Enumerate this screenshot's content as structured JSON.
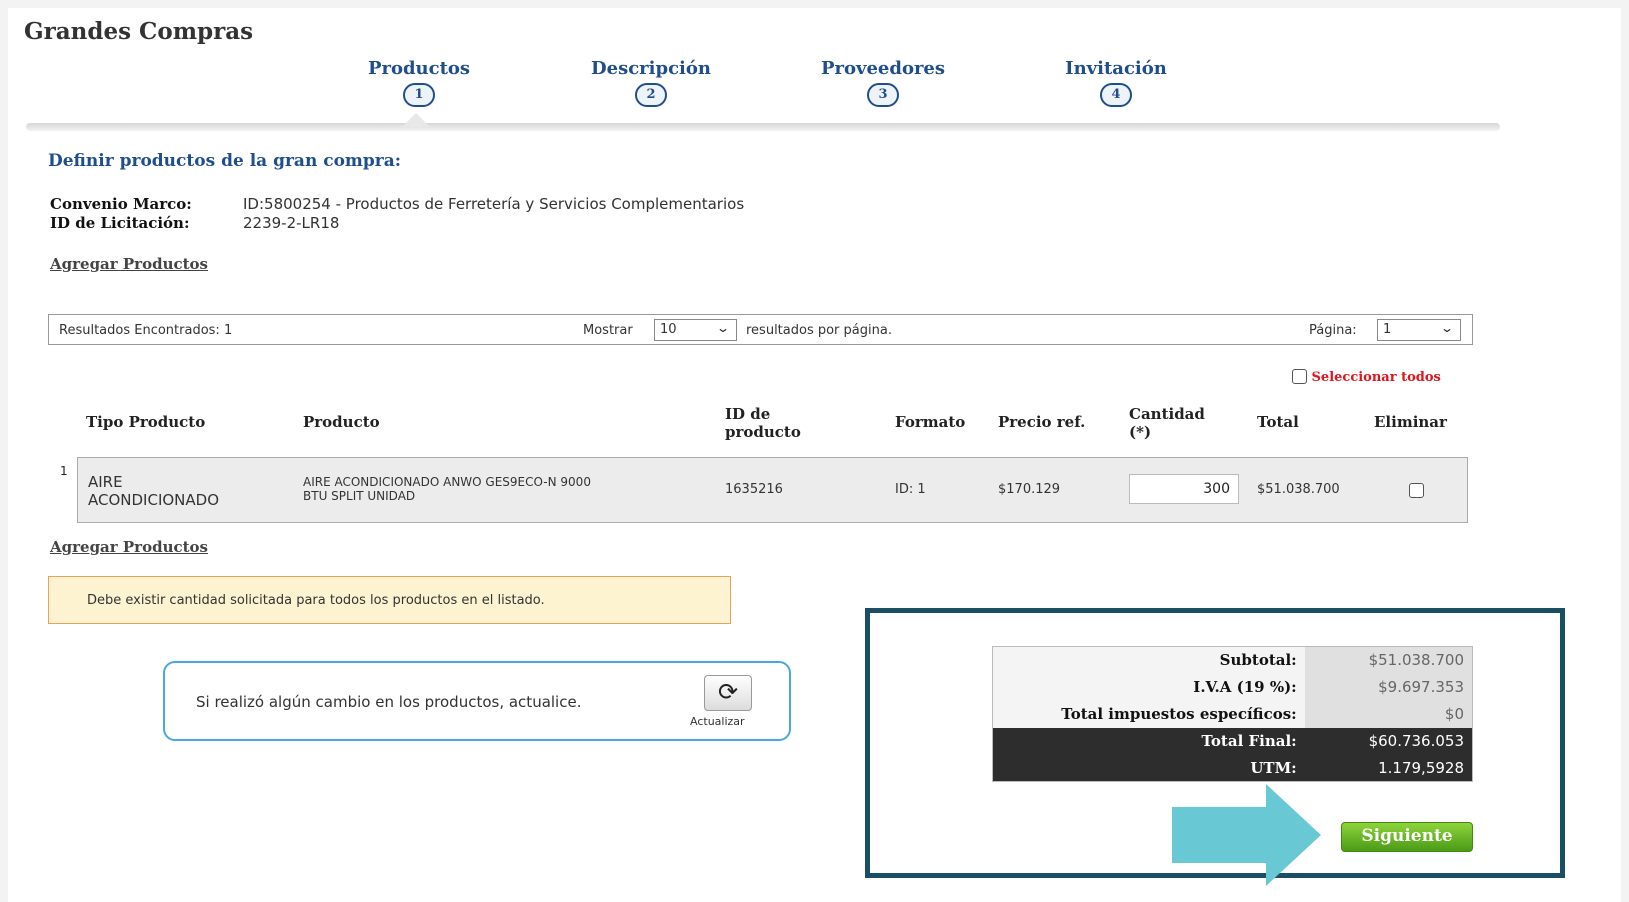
{
  "app": {
    "title": "Grandes Compras"
  },
  "steps": [
    {
      "label": "Productos",
      "number": "1"
    },
    {
      "label": "Descripción",
      "number": "2"
    },
    {
      "label": "Proveedores",
      "number": "3"
    },
    {
      "label": "Invitación",
      "number": "4"
    }
  ],
  "section": {
    "title": "Definir productos de la gran compra:",
    "convenio_label": "Convenio Marco:",
    "convenio_value": "ID:5800254 - Productos de Ferretería y Servicios Complementarios",
    "licitacion_label": "ID de Licitación:",
    "licitacion_value": "2239-2-LR18",
    "add_products": "Agregar Productos"
  },
  "results": {
    "found": "Resultados Encontrados: 1",
    "show_label": "Mostrar",
    "show_value": "10",
    "per_page_label": "resultados por página.",
    "page_label": "Página:",
    "page_value": "1"
  },
  "select_all": "Seleccionar todos",
  "table": {
    "headers": {
      "tipo": "Tipo Producto",
      "producto": "Producto",
      "id_line1": "ID de",
      "id_line2": "producto",
      "formato": "Formato",
      "precio": "Precio ref.",
      "cantidad_line1": "Cantidad",
      "cantidad_line2": "(*)",
      "total": "Total",
      "eliminar": "Eliminar"
    },
    "rows": [
      {
        "index": "1",
        "tipo_line1": "AIRE",
        "tipo_line2": "ACONDICIONADO",
        "producto_line1": "AIRE ACONDICIONADO ANWO GES9ECO-N 9000",
        "producto_line2": "BTU SPLIT UNIDAD",
        "id": "1635216",
        "formato": "ID: 1",
        "precio": "$170.129",
        "cantidad": "300",
        "total": "$51.038.700"
      }
    ]
  },
  "warning": "Debe existir cantidad solicitada para todos los productos en el listado.",
  "update": {
    "message": "Si realizó algún cambio en los productos, actualice.",
    "button_label": "Actualizar"
  },
  "totals": {
    "subtotal_label": "Subtotal:",
    "subtotal": "$51.038.700",
    "iva_label": "I.V.A (19 %):",
    "iva": "$9.697.353",
    "impuestos_label": "Total impuestos específicos:",
    "impuestos": "$0",
    "final_label": "Total Final:",
    "final": "$60.736.053",
    "utm_label": "UTM:",
    "utm": "1.179,5928"
  },
  "next_button": "Siguiente",
  "colors": {
    "accent_blue": "#1f4e8e",
    "danger_red": "#e0141b",
    "warning_bg": "#fdf3d1",
    "panel_border": "#1a4f63",
    "arrow": "#68c8d4",
    "next_green": "#4a9b17"
  }
}
